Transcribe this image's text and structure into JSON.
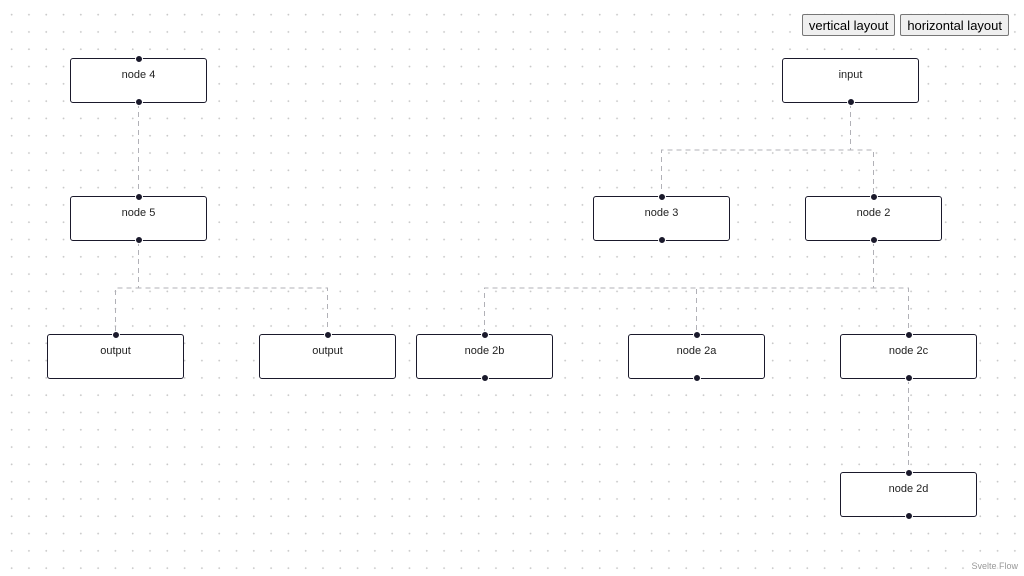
{
  "panel": {
    "vertical_label": "vertical layout",
    "horizontal_label": "horizontal layout"
  },
  "nodes": [
    {
      "id": "4",
      "label": "node 4"
    },
    {
      "id": "5",
      "label": "node 5"
    },
    {
      "id": "5a",
      "label": "output"
    },
    {
      "id": "5b",
      "label": "output"
    },
    {
      "id": "1",
      "label": "input"
    },
    {
      "id": "3",
      "label": "node 3"
    },
    {
      "id": "2",
      "label": "node 2"
    },
    {
      "id": "2b",
      "label": "node 2b"
    },
    {
      "id": "2a",
      "label": "node 2a"
    },
    {
      "id": "2c",
      "label": "node 2c"
    },
    {
      "id": "2d",
      "label": "node 2d"
    }
  ],
  "edges": [
    {
      "source": "4",
      "target": "5",
      "style": "dashed"
    },
    {
      "source": "5",
      "target": "5a",
      "style": "dashed"
    },
    {
      "source": "5",
      "target": "5b",
      "style": "dashed"
    },
    {
      "source": "1",
      "target": "3",
      "style": "dashed"
    },
    {
      "source": "1",
      "target": "2",
      "style": "dashed"
    },
    {
      "source": "2",
      "target": "2b",
      "style": "dashed"
    },
    {
      "source": "2",
      "target": "2a",
      "style": "dashed"
    },
    {
      "source": "2",
      "target": "2c",
      "style": "dashed"
    },
    {
      "source": "2c",
      "target": "2d",
      "style": "dashed"
    }
  ],
  "attribution": "Svelte Flow",
  "colors": {
    "node_border": "#1a192b",
    "edge": "#b1b1b7",
    "background_dots": "#c9c9c9"
  }
}
